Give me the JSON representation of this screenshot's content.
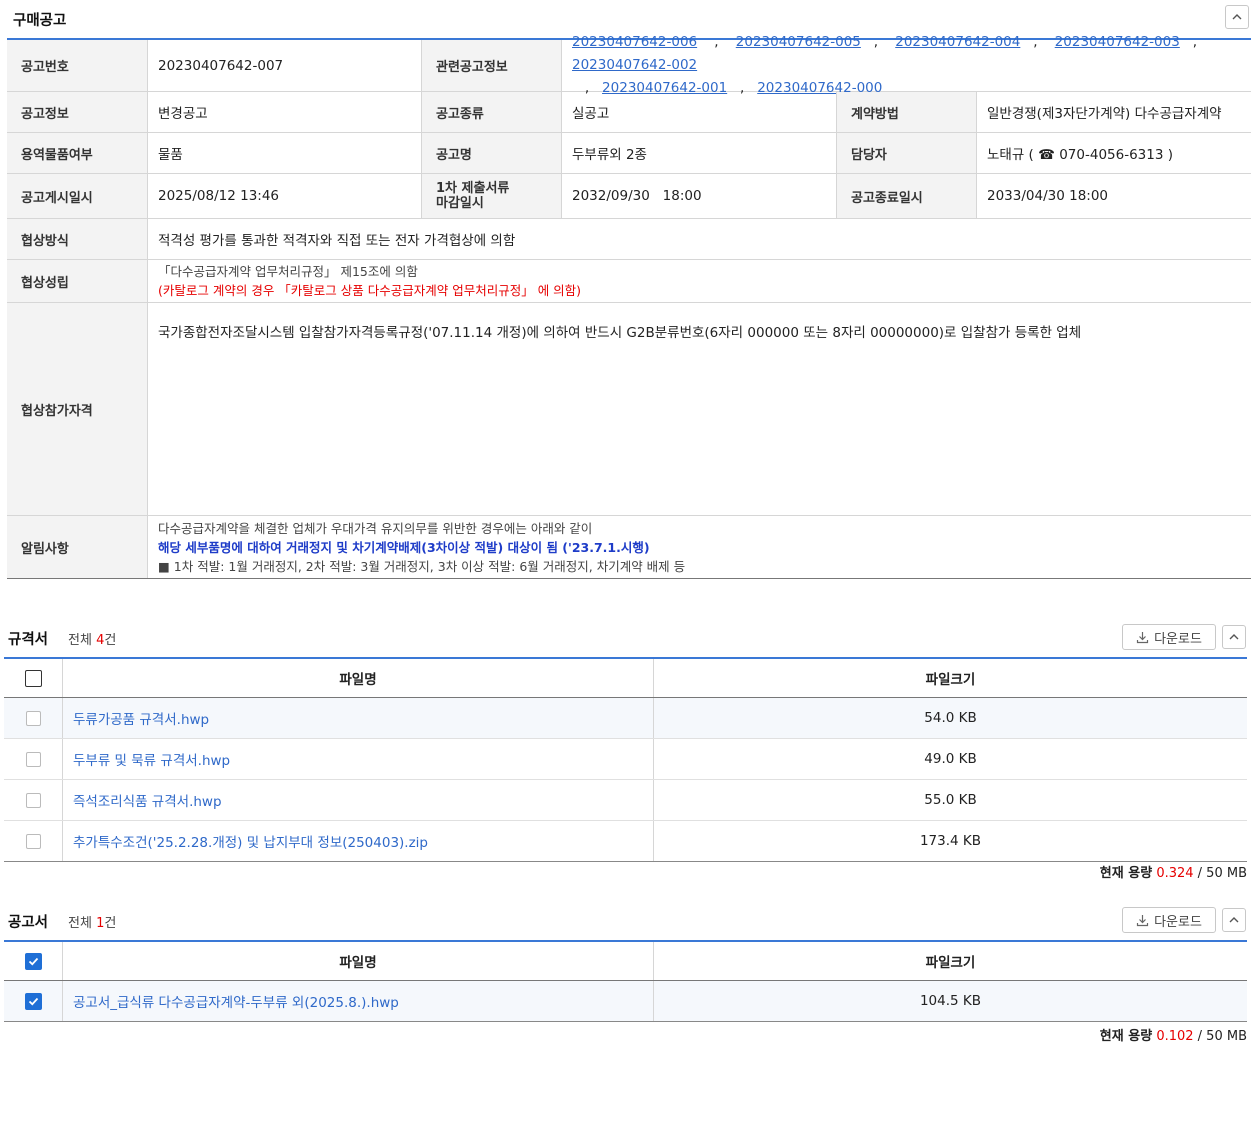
{
  "notice": {
    "title": "구매공고",
    "labels": {
      "no": "공고번호",
      "related": "관련공고정보",
      "info": "공고정보",
      "kind": "공고종류",
      "contract": "계약방법",
      "svc": "용역물품여부",
      "name": "공고명",
      "manager": "담당자",
      "posted": "공고게시일시",
      "deadline1": "1차 제출서류",
      "deadline2": "마감일시",
      "end": "공고종료일시",
      "method": "협상방식",
      "estab": "협상성립",
      "qual": "협상참가자격",
      "notice": "알림사항"
    },
    "no": "20230407642-007",
    "related": [
      "20230407642-006",
      "20230407642-005",
      "20230407642-004",
      "20230407642-003",
      "20230407642-002",
      "20230407642-001",
      "20230407642-000"
    ],
    "info": "변경공고",
    "kind": "실공고",
    "contract": "일반경쟁(제3자단가계약) 다수공급자계약",
    "svc": "물품",
    "name": "두부류외 2종",
    "manager": "노태규 ( ☎ 070-4056-6313 )",
    "posted": "2025/08/12 13:46",
    "deadline": "2032/09/30   18:00",
    "end": "2033/04/30 18:00",
    "method": "적격성 평가를 통과한 적격자와 직접 또는 전자 가격협상에 의함",
    "estab_line1": "「다수공급자계약 업무처리규정」 제15조에 의함",
    "estab_line2": "(카탈로그 계약의 경우 「카탈로그 상품 다수공급자계약 업무처리규정」 에 의함)",
    "qual": "국가종합전자조달시스템 입찰참가자격등록규정('07.11.14 개정)에 의하여 반드시 G2B분류번호(6자리 000000 또는 8자리 00000000)로 입찰참가 등록한 업체",
    "notice_line1": "다수공급자계약을 체결한 업체가 우대가격 유지의무를 위반한 경우에는 아래와 같이",
    "notice_line2": "해당 세부품명에 대하여 거래정지 및 차기계약배제(3차이상 적발) 대상이 됨 ('23.7.1.시행)",
    "notice_line3": "■ 1차 적발: 1월 거래정지, 2차 적발: 3월 거래정지, 3차 이상 적발: 6월 거래정지, 차기계약 배제 등"
  },
  "spec": {
    "title": "규격서",
    "count_prefix": "전체 ",
    "count": "4",
    "count_suffix": "건",
    "download": "다운로드",
    "col_name": "파일명",
    "col_size": "파일크기",
    "files": [
      {
        "name": "두류가공품 규격서.hwp",
        "size": "54.0 KB"
      },
      {
        "name": "두부류 및 묵류 규격서.hwp",
        "size": "49.0 KB"
      },
      {
        "name": "즉석조리식품 규격서.hwp",
        "size": "55.0 KB"
      },
      {
        "name": "추가특수조건('25.2.28.개정) 및 납지부대 정보(250403).zip",
        "size": "173.4 KB"
      }
    ],
    "cap_label": "현재 용량",
    "cap_used": "0.324",
    "cap_total": "/ 50 MB"
  },
  "ann": {
    "title": "공고서",
    "count_prefix": "전체 ",
    "count": "1",
    "count_suffix": "건",
    "download": "다운로드",
    "col_name": "파일명",
    "col_size": "파일크기",
    "files": [
      {
        "name": "공고서_급식류 다수공급자계약-두부류 외(2025.8.).hwp",
        "size": "104.5 KB"
      }
    ],
    "cap_label": "현재 용량",
    "cap_used": "0.102",
    "cap_total": "/ 50 MB"
  },
  "icons": {
    "collapse": "chevron-up-icon",
    "download": "download-icon",
    "phone": "phone-icon",
    "check": "check-icon"
  },
  "colors": {
    "accent": "#3a78d6",
    "link": "#2f69c9",
    "red": "#e60000",
    "blue": "#1e3cc8"
  }
}
